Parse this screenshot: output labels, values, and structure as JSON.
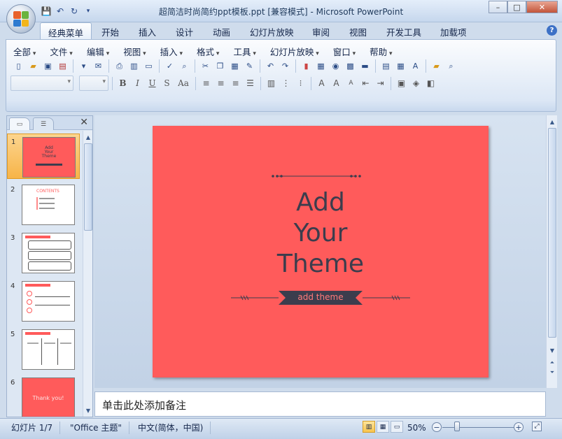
{
  "window": {
    "title": "超简洁时尚简约ppt模板.ppt [兼容模式] - Microsoft PowerPoint",
    "controls": {
      "minimize": "–",
      "maximize": "□",
      "close": "✕"
    }
  },
  "quick_access": [
    "save-icon",
    "undo-icon",
    "redo-icon",
    "customize-icon"
  ],
  "ribbon_tabs": [
    "经典菜单",
    "开始",
    "插入",
    "设计",
    "动画",
    "幻灯片放映",
    "审阅",
    "视图",
    "开发工具",
    "加载项"
  ],
  "active_tab": "经典菜单",
  "classic_menu": [
    "全部",
    "文件",
    "编辑",
    "视图",
    "插入",
    "格式",
    "工具",
    "幻灯片放映",
    "窗口",
    "帮助"
  ],
  "format_buttons": {
    "bold": "B",
    "italic": "I",
    "underline": "U",
    "shadow": "S",
    "font_size": "Aa"
  },
  "slide_panel": {
    "slides": [
      {
        "number": "1",
        "selected": true,
        "lines": [
          "Add",
          "Your",
          "Theme"
        ]
      },
      {
        "number": "2",
        "title": "CONTENTS"
      },
      {
        "number": "3"
      },
      {
        "number": "4"
      },
      {
        "number": "5"
      },
      {
        "number": "6",
        "text": "Thank you!"
      }
    ]
  },
  "slide": {
    "title_lines": [
      "Add",
      "Your",
      "Theme"
    ],
    "ribbon_label": "add theme",
    "background": "#ff5b5b",
    "text_color": "#3c3d4d"
  },
  "notes_placeholder": "单击此处添加备注",
  "status": {
    "slide_info": "幻灯片 1/7",
    "theme": "\"Office 主题\"",
    "language": "中文(简体，中国)",
    "zoom": "50%",
    "zoom_fraction": 0.2
  }
}
